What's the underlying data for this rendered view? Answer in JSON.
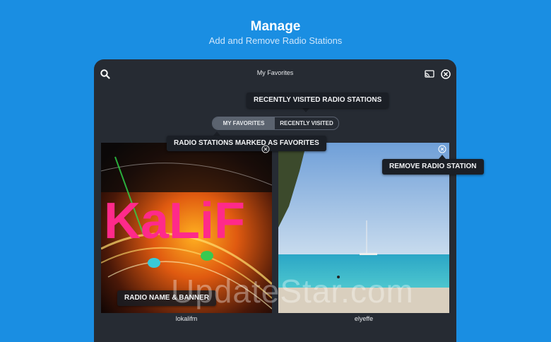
{
  "hero": {
    "title": "Manage",
    "subtitle": "Add and Remove Radio Stations"
  },
  "app": {
    "title": "My Favorites",
    "icons": {
      "search": "search-icon",
      "cast": "cast-icon",
      "close": "close-circle-icon"
    },
    "tabs": [
      {
        "label": "MY FAVORITES",
        "selected": true
      },
      {
        "label": "RECENTLY VISITED",
        "selected": false
      }
    ],
    "stations": [
      {
        "name": "lokalifm",
        "banner_text": "KaLiF"
      },
      {
        "name": "elyeffe"
      }
    ]
  },
  "tooltips": {
    "recent": "RECENTLY VISITED RADIO STATIONS",
    "favorites": "RADIO STATIONS MARKED AS FAVORITES",
    "remove": "REMOVE RADIO STATION",
    "name_banner": "RADIO NAME & BANNER"
  },
  "watermark": "UpdateStar.com",
  "colors": {
    "background": "#1a8ee2",
    "tablet": "#262b33"
  }
}
